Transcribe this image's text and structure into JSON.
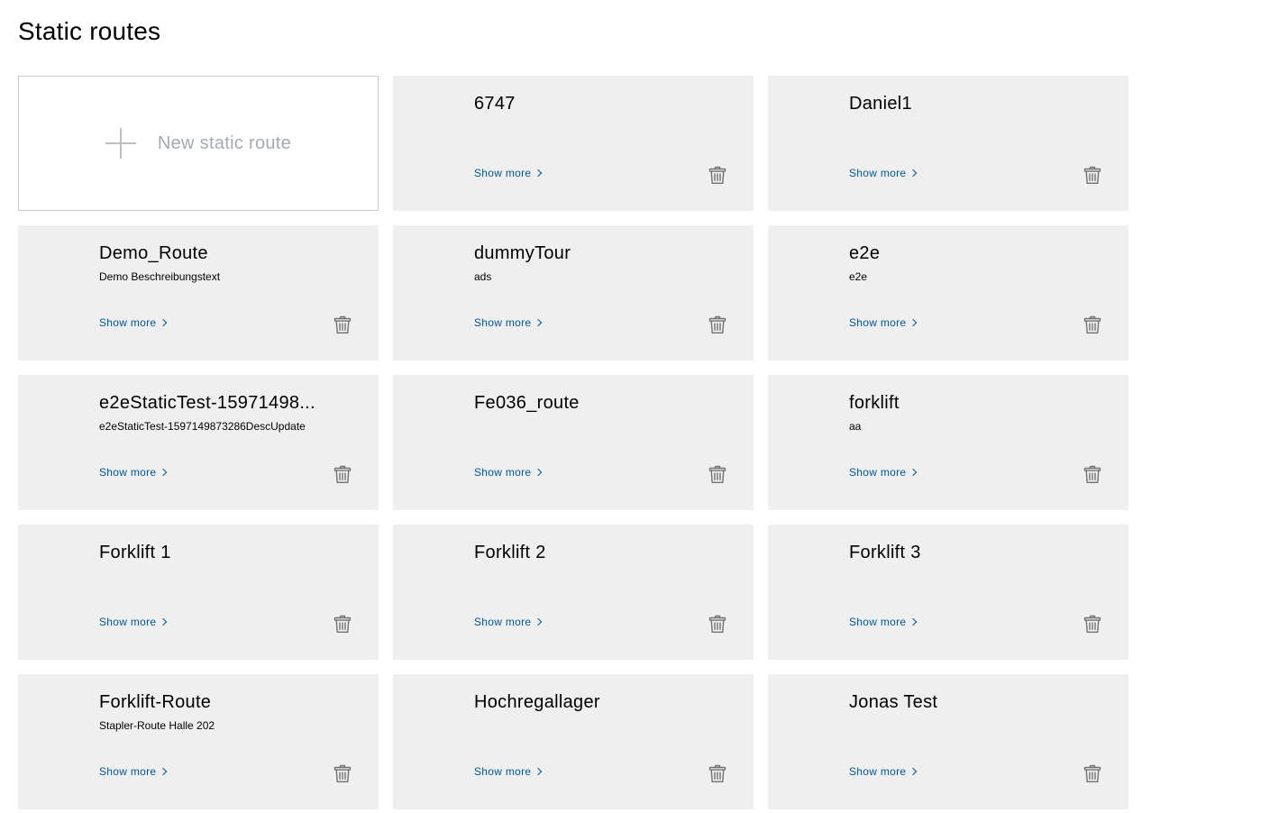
{
  "page": {
    "title": "Static routes"
  },
  "new_route": {
    "label": "New static route",
    "icon": "plus-icon"
  },
  "colors": {
    "card_background": "#efefef",
    "link": "#005691",
    "trash_icon": "#6f7173"
  },
  "show_more_label": "Show more",
  "routes": [
    {
      "title": "6747",
      "description": ""
    },
    {
      "title": "Daniel1",
      "description": ""
    },
    {
      "title": "Demo_Route",
      "description": "Demo Beschreibungstext"
    },
    {
      "title": "dummyTour",
      "description": "ads"
    },
    {
      "title": "e2e",
      "description": "e2e"
    },
    {
      "title": "e2eStaticTest-15971498...",
      "description": "e2eStaticTest-1597149873286DescUpdate"
    },
    {
      "title": "Fe036_route",
      "description": ""
    },
    {
      "title": "forklift",
      "description": "aa"
    },
    {
      "title": "Forklift 1",
      "description": ""
    },
    {
      "title": "Forklift 2",
      "description": ""
    },
    {
      "title": "Forklift 3",
      "description": ""
    },
    {
      "title": "Forklift-Route",
      "description": "Stapler-Route Halle 202"
    },
    {
      "title": "Hochregallager",
      "description": ""
    },
    {
      "title": "Jonas Test",
      "description": ""
    }
  ]
}
